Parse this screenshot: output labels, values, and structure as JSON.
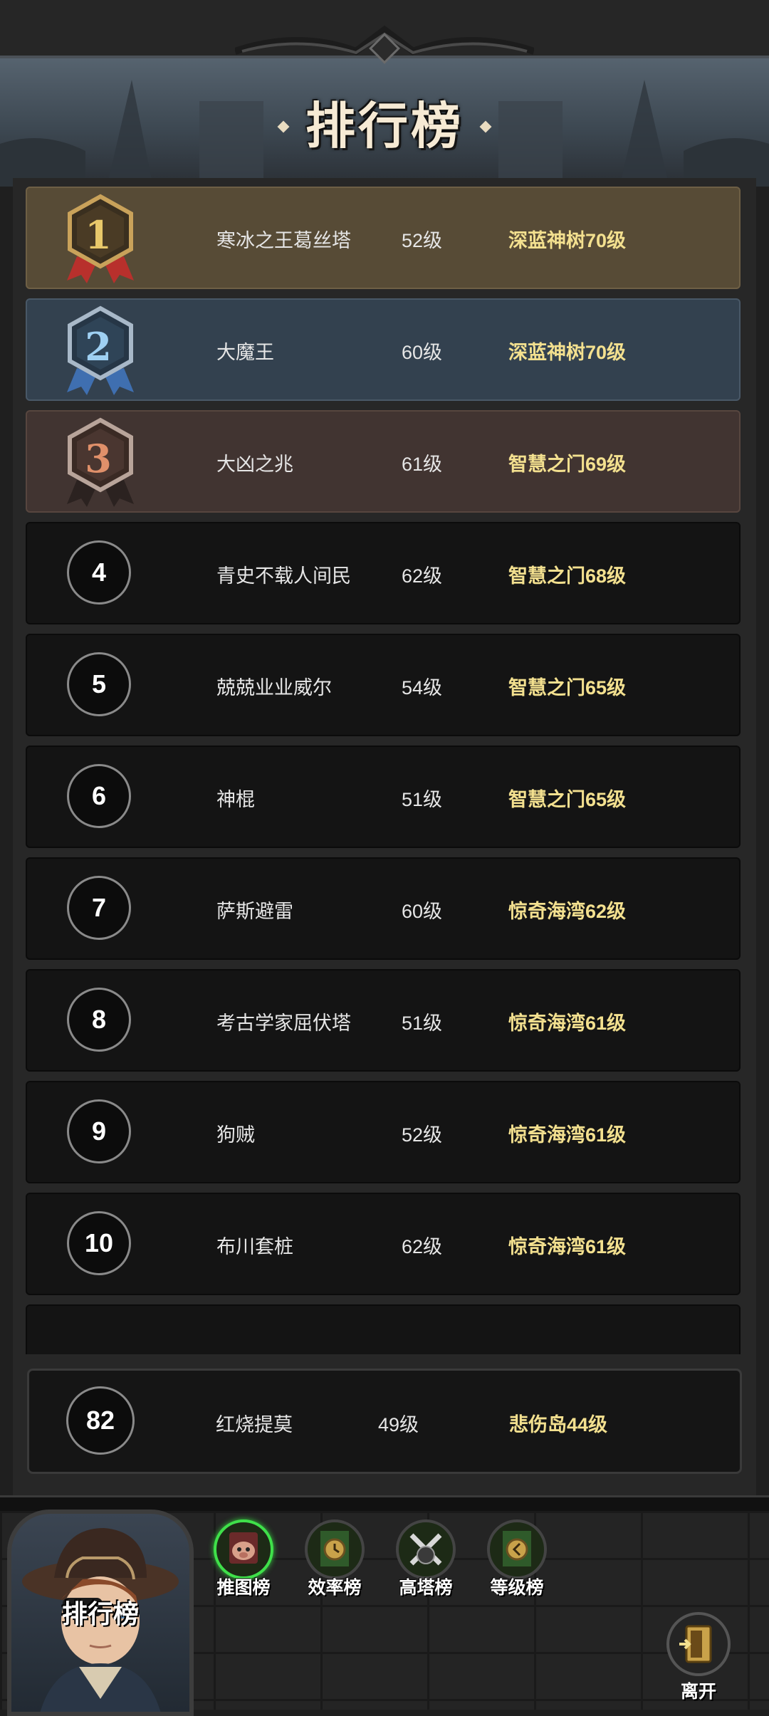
{
  "header": {
    "title": "排行榜"
  },
  "rankings": [
    {
      "rank": "1",
      "name": "寒冰之王葛丝塔",
      "level": "52级",
      "zone": "深蓝神树70级",
      "tier": "gold"
    },
    {
      "rank": "2",
      "name": "大魔王",
      "level": "60级",
      "zone": "深蓝神树70级",
      "tier": "silver"
    },
    {
      "rank": "3",
      "name": "大凶之兆",
      "level": "61级",
      "zone": "智慧之门69级",
      "tier": "bronze"
    },
    {
      "rank": "4",
      "name": "青史不载人间民",
      "level": "62级",
      "zone": "智慧之门68级",
      "tier": "normal"
    },
    {
      "rank": "5",
      "name": "兢兢业业威尔",
      "level": "54级",
      "zone": "智慧之门65级",
      "tier": "normal"
    },
    {
      "rank": "6",
      "name": "神棍",
      "level": "51级",
      "zone": "智慧之门65级",
      "tier": "normal"
    },
    {
      "rank": "7",
      "name": "萨斯避雷",
      "level": "60级",
      "zone": "惊奇海湾62级",
      "tier": "normal"
    },
    {
      "rank": "8",
      "name": "考古学家屈伏塔",
      "level": "51级",
      "zone": "惊奇海湾61级",
      "tier": "normal"
    },
    {
      "rank": "9",
      "name": "狗贼",
      "level": "52级",
      "zone": "惊奇海湾61级",
      "tier": "normal"
    },
    {
      "rank": "10",
      "name": "布川套桩",
      "level": "62级",
      "zone": "惊奇海湾61级",
      "tier": "normal"
    }
  ],
  "my_rank": {
    "rank": "82",
    "name": "红烧提莫",
    "level": "49级",
    "zone": "悲伤岛44级"
  },
  "bottom": {
    "portrait_label": "排行榜",
    "tabs": [
      {
        "label": "推图榜",
        "icon": "pig-map-icon",
        "active": true
      },
      {
        "label": "效率榜",
        "icon": "clock-banner-icon",
        "active": false
      },
      {
        "label": "高塔榜",
        "icon": "crossed-swords-icon",
        "active": false
      },
      {
        "label": "等级榜",
        "icon": "level-banner-icon",
        "active": false
      }
    ],
    "exit_label": "离开"
  },
  "colors": {
    "gold_row": "#574b36",
    "silver_row": "#33414f",
    "bronze_row": "#413431",
    "zone_text": "#f3e08f",
    "active_tab_ring": "#3fe04a"
  }
}
